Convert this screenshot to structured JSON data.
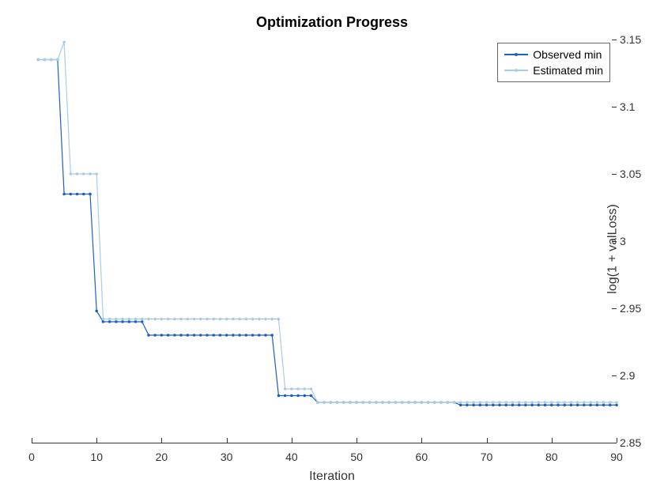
{
  "chart_data": {
    "type": "line",
    "title": "Optimization Progress",
    "xlabel": "Iteration",
    "ylabel": "log(1 + valLoss)",
    "xlim": [
      0,
      90
    ],
    "ylim": [
      2.85,
      3.15
    ],
    "xticks": [
      0,
      10,
      20,
      30,
      40,
      50,
      60,
      70,
      80,
      90
    ],
    "yticks": [
      2.85,
      2.9,
      2.95,
      3.0,
      3.05,
      3.1,
      3.15
    ],
    "legend_position": "upper-right",
    "series": [
      {
        "name": "Observed min",
        "color": "#1f5fbf",
        "x": [
          1,
          2,
          3,
          4,
          5,
          6,
          7,
          8,
          9,
          10,
          11,
          12,
          13,
          14,
          15,
          16,
          17,
          18,
          19,
          20,
          21,
          22,
          23,
          24,
          25,
          26,
          27,
          28,
          29,
          30,
          31,
          32,
          33,
          34,
          35,
          36,
          37,
          38,
          39,
          40,
          41,
          42,
          43,
          44,
          45,
          46,
          47,
          48,
          49,
          50,
          51,
          52,
          53,
          54,
          55,
          56,
          57,
          58,
          59,
          60,
          61,
          62,
          63,
          64,
          65,
          66,
          67,
          68,
          69,
          70,
          71,
          72,
          73,
          74,
          75,
          76,
          77,
          78,
          79,
          80,
          81,
          82,
          83,
          84,
          85,
          86,
          87,
          88,
          89,
          90
        ],
        "y": [
          3.135,
          3.135,
          3.135,
          3.135,
          3.035,
          3.035,
          3.035,
          3.035,
          3.035,
          2.948,
          2.94,
          2.94,
          2.94,
          2.94,
          2.94,
          2.94,
          2.94,
          2.93,
          2.93,
          2.93,
          2.93,
          2.93,
          2.93,
          2.93,
          2.93,
          2.93,
          2.93,
          2.93,
          2.93,
          2.93,
          2.93,
          2.93,
          2.93,
          2.93,
          2.93,
          2.93,
          2.93,
          2.885,
          2.885,
          2.885,
          2.885,
          2.885,
          2.885,
          2.88,
          2.88,
          2.88,
          2.88,
          2.88,
          2.88,
          2.88,
          2.88,
          2.88,
          2.88,
          2.88,
          2.88,
          2.88,
          2.88,
          2.88,
          2.88,
          2.88,
          2.88,
          2.88,
          2.88,
          2.88,
          2.88,
          2.878,
          2.878,
          2.878,
          2.878,
          2.878,
          2.878,
          2.878,
          2.878,
          2.878,
          2.878,
          2.878,
          2.878,
          2.878,
          2.878,
          2.878,
          2.878,
          2.878,
          2.878,
          2.878,
          2.878,
          2.878,
          2.878,
          2.878,
          2.878,
          2.878
        ]
      },
      {
        "name": "Estimated min",
        "color": "#a8cce8",
        "x": [
          1,
          2,
          3,
          4,
          5,
          6,
          7,
          8,
          9,
          10,
          11,
          12,
          13,
          14,
          15,
          16,
          17,
          18,
          19,
          20,
          21,
          22,
          23,
          24,
          25,
          26,
          27,
          28,
          29,
          30,
          31,
          32,
          33,
          34,
          35,
          36,
          37,
          38,
          39,
          40,
          41,
          42,
          43,
          44,
          45,
          46,
          47,
          48,
          49,
          50,
          51,
          52,
          53,
          54,
          55,
          56,
          57,
          58,
          59,
          60,
          61,
          62,
          63,
          64,
          65,
          66,
          67,
          68,
          69,
          70,
          71,
          72,
          73,
          74,
          75,
          76,
          77,
          78,
          79,
          80,
          81,
          82,
          83,
          84,
          85,
          86,
          87,
          88,
          89,
          90
        ],
        "y": [
          3.135,
          3.135,
          3.135,
          3.135,
          3.148,
          3.05,
          3.05,
          3.05,
          3.05,
          3.05,
          2.942,
          2.942,
          2.942,
          2.942,
          2.942,
          2.942,
          2.942,
          2.942,
          2.942,
          2.942,
          2.942,
          2.942,
          2.942,
          2.942,
          2.942,
          2.942,
          2.942,
          2.942,
          2.942,
          2.942,
          2.942,
          2.942,
          2.942,
          2.942,
          2.942,
          2.942,
          2.942,
          2.942,
          2.89,
          2.89,
          2.89,
          2.89,
          2.89,
          2.88,
          2.88,
          2.88,
          2.88,
          2.88,
          2.88,
          2.88,
          2.88,
          2.88,
          2.88,
          2.88,
          2.88,
          2.88,
          2.88,
          2.88,
          2.88,
          2.88,
          2.88,
          2.88,
          2.88,
          2.88,
          2.88,
          2.88,
          2.88,
          2.88,
          2.88,
          2.88,
          2.88,
          2.88,
          2.88,
          2.88,
          2.88,
          2.88,
          2.88,
          2.88,
          2.88,
          2.88,
          2.88,
          2.88,
          2.88,
          2.88,
          2.88,
          2.88,
          2.88,
          2.88,
          2.88,
          2.88
        ]
      }
    ]
  }
}
